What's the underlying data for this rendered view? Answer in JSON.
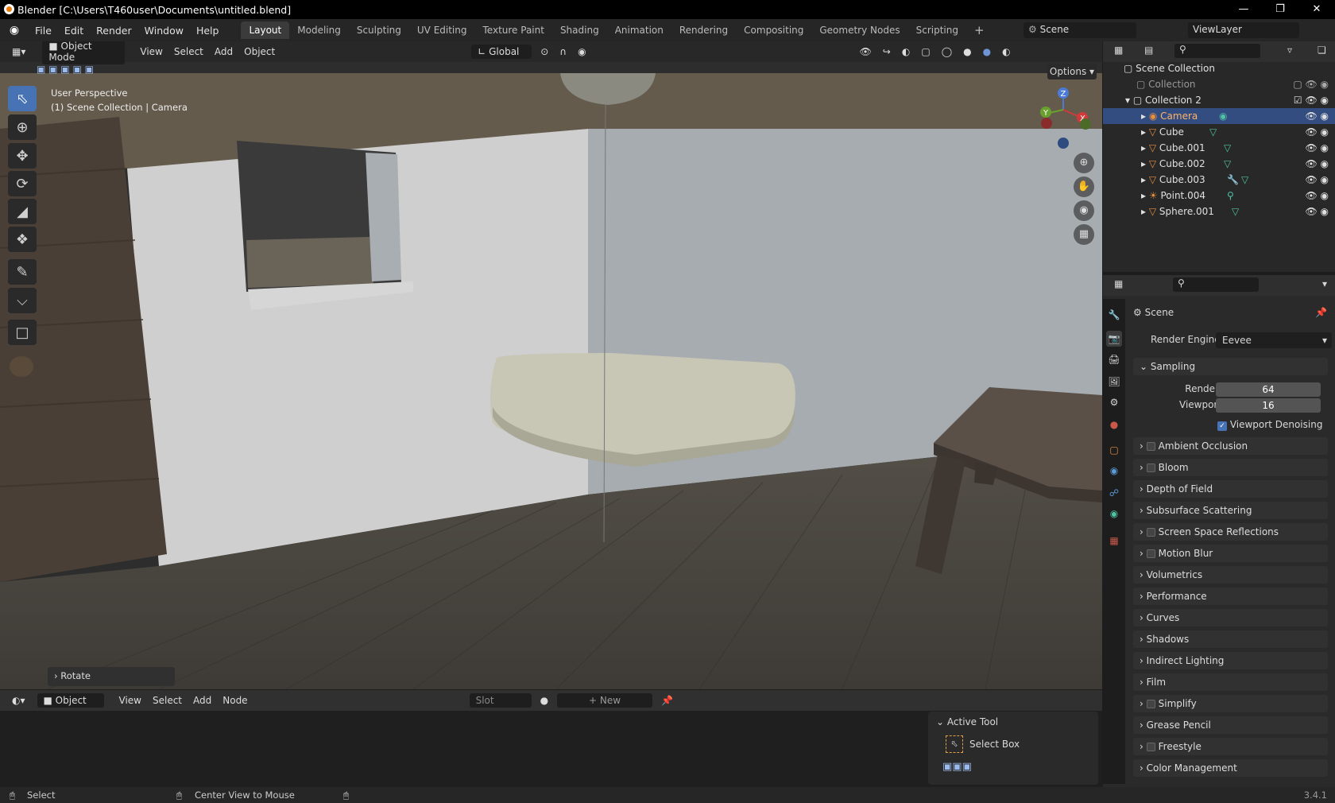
{
  "titlebar": {
    "title": "Blender [C:\\Users\\T460user\\Documents\\untitled.blend]"
  },
  "menus": [
    "File",
    "Edit",
    "Render",
    "Window",
    "Help"
  ],
  "workspaces": [
    "Layout",
    "Modeling",
    "Sculpting",
    "UV Editing",
    "Texture Paint",
    "Shading",
    "Animation",
    "Rendering",
    "Compositing",
    "Geometry Nodes",
    "Scripting"
  ],
  "active_workspace": "Layout",
  "scene_name": "Scene",
  "view_layer": "ViewLayer",
  "viewport": {
    "mode": "Object Mode",
    "menu": [
      "View",
      "Select",
      "Add",
      "Object"
    ],
    "orientation": "Global",
    "options": "Options",
    "info_line1": "User Perspective",
    "info_line2": "(1) Scene Collection | Camera",
    "rotate_panel": "Rotate"
  },
  "outliner": {
    "root": "Scene Collection",
    "collection": "Collection",
    "collection2": "Collection 2",
    "items": [
      "Camera",
      "Cube",
      "Cube.001",
      "Cube.002",
      "Cube.003",
      "Point.004",
      "Sphere.001"
    ],
    "selected": "Camera"
  },
  "properties": {
    "context": "Scene",
    "render_engine_label": "Render Engine",
    "render_engine": "Eevee",
    "sampling": "Sampling",
    "render_label": "Render",
    "render_value": "64",
    "viewport_label": "Viewport",
    "viewport_value": "16",
    "denoise": "Viewport Denoising",
    "panels": [
      "Ambient Occlusion",
      "Bloom",
      "Depth of Field",
      "Subsurface Scattering",
      "Screen Space Reflections",
      "Motion Blur",
      "Volumetrics",
      "Performance",
      "Curves",
      "Shadows",
      "Indirect Lighting",
      "Film",
      "Simplify",
      "Grease Pencil",
      "Freestyle",
      "Color Management"
    ]
  },
  "node_editor": {
    "mode": "Object",
    "menu": [
      "View",
      "Select",
      "Add",
      "Node"
    ],
    "slot": "Slot",
    "new": "New"
  },
  "active_tool": {
    "title": "Active Tool",
    "tool": "Select Box"
  },
  "statusbar": {
    "select": "Select",
    "center": "Center View to Mouse",
    "version": "3.4.1"
  }
}
